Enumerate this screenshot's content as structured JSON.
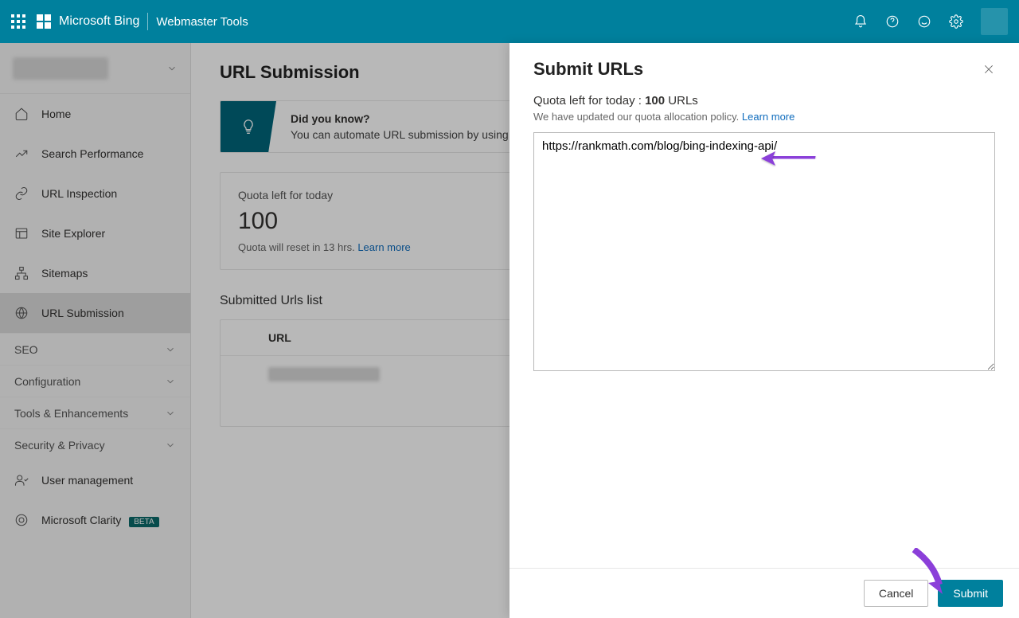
{
  "header": {
    "brand_main": "Microsoft Bing",
    "brand_sub": "Webmaster Tools"
  },
  "sidebar": {
    "items": [
      {
        "label": "Home"
      },
      {
        "label": "Search Performance"
      },
      {
        "label": "URL Inspection"
      },
      {
        "label": "Site Explorer"
      },
      {
        "label": "Sitemaps"
      },
      {
        "label": "URL Submission"
      }
    ],
    "groups": [
      {
        "label": "SEO"
      },
      {
        "label": "Configuration"
      },
      {
        "label": "Tools & Enhancements"
      },
      {
        "label": "Security & Privacy"
      }
    ],
    "user_mgmt": "User management",
    "clarity": "Microsoft Clarity",
    "beta_badge": "BETA"
  },
  "content": {
    "page_title": "URL Submission",
    "dyk_title": "Did you know?",
    "dyk_text": "You can automate URL submission by using ou",
    "quota_card_label": "Quota left for today",
    "quota_card_value": "100",
    "quota_card_reset": "Quota will reset in 13 hrs.",
    "quota_card_learn": "Learn more",
    "sub_list_title": "Submitted Urls list",
    "sub_table_head": "URL"
  },
  "panel": {
    "title": "Submit URLs",
    "quota_prefix": "Quota left for today : ",
    "quota_value": "100",
    "quota_suffix": " URLs",
    "policy_text": "We have updated our quota allocation policy.",
    "policy_learn": "Learn more",
    "textarea_value": "https://rankmath.com/blog/bing-indexing-api/",
    "cancel": "Cancel",
    "submit": "Submit"
  }
}
